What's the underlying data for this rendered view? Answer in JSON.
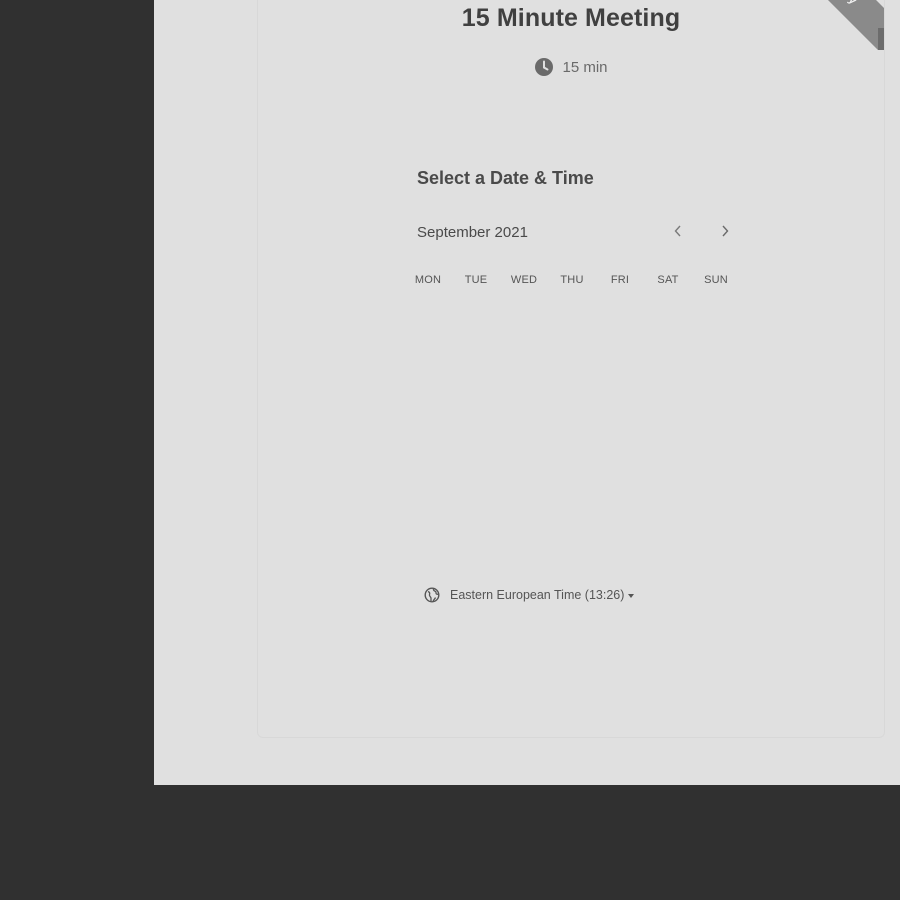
{
  "meeting": {
    "title": "15 Minute Meeting",
    "duration": "15 min"
  },
  "ribbon": {
    "text": "dly"
  },
  "scheduler": {
    "heading": "Select a Date & Time",
    "month": "September 2021",
    "weekdays": [
      "MON",
      "TUE",
      "WED",
      "THU",
      "FRI",
      "SAT",
      "SUN"
    ]
  },
  "timezone": {
    "label": "Eastern European Time (13:26)"
  },
  "colors": {
    "backdrop": "#303030",
    "panel": "#e0e0e0",
    "text_dark": "#404040",
    "text_muted": "#6a6a6a",
    "ribbon": "#8a8a8a"
  },
  "icons": {
    "duration": "clock-icon",
    "timezone": "globe-icon",
    "prev": "chevron-left-icon",
    "next": "chevron-right-icon",
    "dropdown": "caret-down-icon"
  }
}
